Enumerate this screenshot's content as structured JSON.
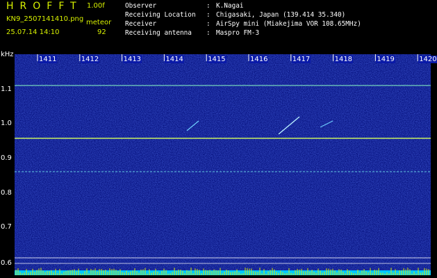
{
  "header": {
    "app_title": "HROFFT",
    "version": "1.00f",
    "filename": "KN9_2507141410.png",
    "datetime": "25.07.14 14:10",
    "meteor_label": "meteor",
    "meteor_count": "92"
  },
  "station": {
    "rows": [
      {
        "key": "Observer",
        "value": "K.Nagai"
      },
      {
        "key": "Receiving Location",
        "value": "Chigasaki, Japan (139.414 35.340)"
      },
      {
        "key": "Receiver",
        "value": "AirSpy mini (Miakejima VOR 108.65MHz)"
      },
      {
        "key": "Receiving antenna",
        "value": "Maspro FM-3"
      }
    ]
  },
  "axis": {
    "unit": "kHz",
    "y_labels": [
      "1.1",
      "1.0",
      "0.9",
      "0.8",
      "0.7",
      "0.6"
    ],
    "x_labels": [
      "1411",
      "1412",
      "1413",
      "1414",
      "1415",
      "1416",
      "1417",
      "1418",
      "1419",
      "1420"
    ]
  },
  "colors": {
    "background": "#000000",
    "spectrogram": "#0a1aa8",
    "trace": "#d7f000",
    "bottom_bar": "#00c8ff"
  }
}
